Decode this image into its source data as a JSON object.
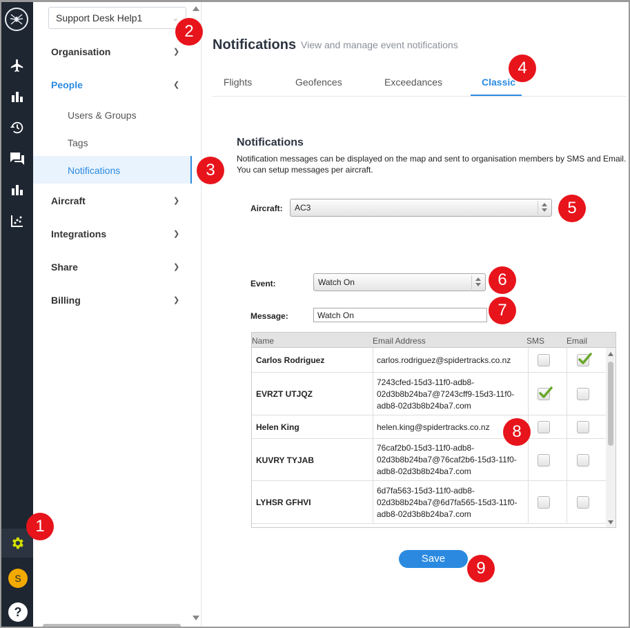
{
  "org_selector": {
    "value": "Support Desk Help1"
  },
  "sidebar": {
    "sections": [
      {
        "label": "Organisation"
      },
      {
        "label": "People"
      },
      {
        "label": "Aircraft"
      },
      {
        "label": "Integrations"
      },
      {
        "label": "Share"
      },
      {
        "label": "Billing"
      }
    ],
    "people_items": [
      {
        "label": "Users & Groups"
      },
      {
        "label": "Tags"
      },
      {
        "label": "Notifications"
      }
    ]
  },
  "rail": {
    "avatar_letter": "S",
    "help_label": "?"
  },
  "page": {
    "title": "Notifications",
    "subtitle": "View and manage event notifications"
  },
  "tabs": [
    {
      "label": "Flights"
    },
    {
      "label": "Geofences"
    },
    {
      "label": "Exceedances"
    },
    {
      "label": "Classic"
    }
  ],
  "notifications": {
    "heading": "Notifications",
    "description_line1": "Notification messages can be displayed on the map and sent to organisation members by SMS and Email.",
    "description_line2": "You can setup messages per aircraft.",
    "aircraft_label": "Aircraft:",
    "aircraft_value": "AC3",
    "event_label": "Event:",
    "event_value": "Watch On",
    "message_label": "Message:",
    "message_value": "Watch On"
  },
  "table": {
    "headers": {
      "name": "Name",
      "email": "Email Address",
      "sms": "SMS",
      "email_col": "Email"
    },
    "rows": [
      {
        "name": "Carlos Rodriguez",
        "email": "carlos.rodriguez@spidertracks.co.nz",
        "sms": false,
        "email_checked": true
      },
      {
        "name": "EVRZT UTJQZ",
        "email": "7243cfed-15d3-11f0-adb8-02d3b8b24ba7@7243cff9-15d3-11f0-adb8-02d3b8b24ba7.com",
        "sms": true,
        "email_checked": false
      },
      {
        "name": "Helen King",
        "email": "helen.king@spidertracks.co.nz",
        "sms": false,
        "email_checked": false
      },
      {
        "name": "KUVRY TYJAB",
        "email": "76caf2b0-15d3-11f0-adb8-02d3b8b24ba7@76caf2b6-15d3-11f0-adb8-02d3b8b24ba7.com",
        "sms": false,
        "email_checked": false
      },
      {
        "name": "LYHSR GFHVI",
        "email": "6d7fa563-15d3-11f0-adb8-02d3b8b24ba7@6d7fa565-15d3-11f0-adb8-02d3b8b24ba7.com",
        "sms": false,
        "email_checked": false
      }
    ],
    "email_lines": [
      [
        "carlos.rodriguez@spidertracks.co.nz"
      ],
      [
        "7243cfed-15d3-11f0-adb8-",
        "02d3b8b24ba7@7243cff9-15d3-11f0-",
        "adb8-02d3b8b24ba7.com"
      ],
      [
        "helen.king@spidertracks.co.nz"
      ],
      [
        "76caf2b0-15d3-11f0-adb8-",
        "02d3b8b24ba7@76caf2b6-15d3-11f0-",
        "adb8-02d3b8b24ba7.com"
      ],
      [
        "6d7fa563-15d3-11f0-adb8-",
        "02d3b8b24ba7@6d7fa565-15d3-11f0-",
        "adb8-02d3b8b24ba7.com"
      ]
    ]
  },
  "save_label": "Save",
  "callouts": [
    "1",
    "2",
    "3",
    "4",
    "5",
    "6",
    "7",
    "8",
    "9"
  ],
  "colors": {
    "accent": "#2b8ae0",
    "rail": "#1e2631",
    "callout": "#e8141b",
    "check": "#6aa82c",
    "gear": "#d4e000"
  }
}
